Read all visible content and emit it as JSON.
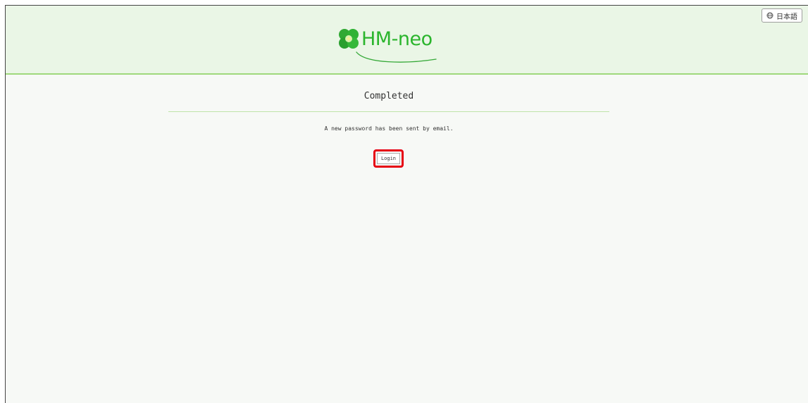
{
  "header": {
    "language_button_label": "日本語",
    "logo_text": "HM-neo"
  },
  "main": {
    "title": "Completed",
    "message": "A new password has been sent by email.",
    "login_button_label": "Login"
  },
  "colors": {
    "header_background": "#eaf6e6",
    "header_border": "#9fd97c",
    "brand_green": "#2bb52d",
    "page_background": "#f7f9f6",
    "highlight_red": "#e60012"
  },
  "icons": {
    "language": "globe-icon",
    "logo": "clover-logo-icon"
  }
}
